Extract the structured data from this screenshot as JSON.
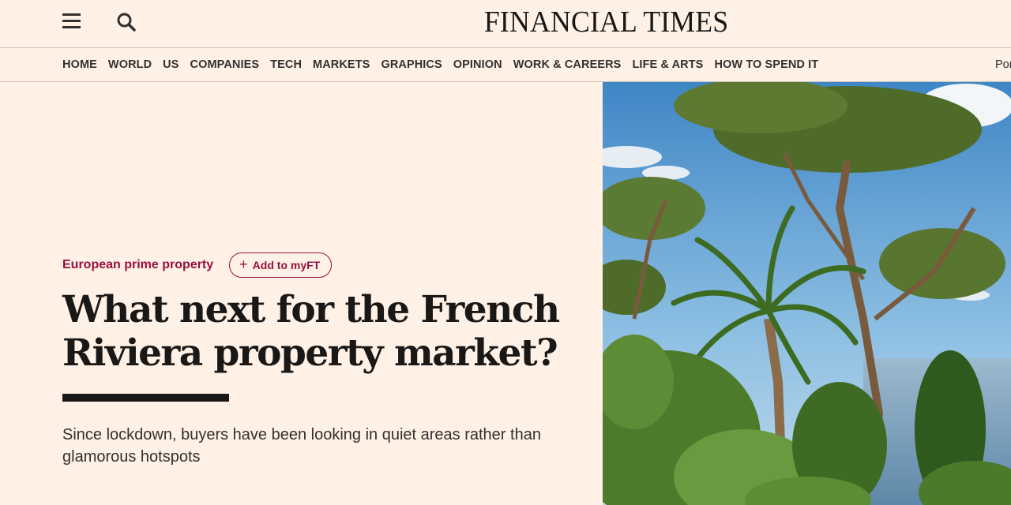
{
  "header": {
    "masthead": "FINANCIAL TIMES",
    "menu_icon": "hamburger-menu-icon",
    "search_icon": "search-icon"
  },
  "nav": {
    "items": [
      "HOME",
      "WORLD",
      "US",
      "COMPANIES",
      "TECH",
      "MARKETS",
      "GRAPHICS",
      "OPINION",
      "WORK & CAREERS",
      "LIFE & ARTS",
      "HOW TO SPEND IT"
    ],
    "overflow_text": "Por"
  },
  "article": {
    "topic": "European prime property",
    "myft_label": "Add to myFT",
    "headline_line1": "What next for the French",
    "headline_line2": "Riviera property market?",
    "standfirst_line1": "Since lockdown, buyers have been looking in quiet areas rather than",
    "standfirst_line2": "glamorous hotspots"
  },
  "colors": {
    "background": "#FFF1E5",
    "claret": "#990F3D",
    "text": "#33302E",
    "rule": "#1A1817"
  }
}
